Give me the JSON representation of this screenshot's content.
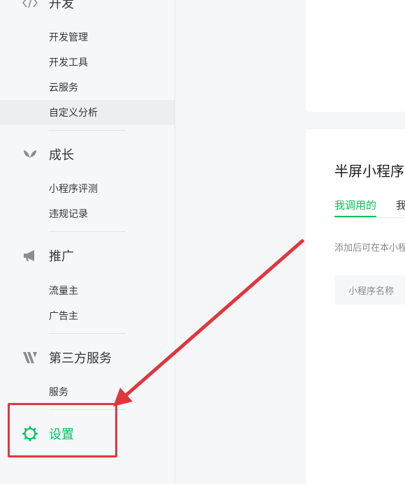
{
  "sidebar": {
    "develop": {
      "label": "开发",
      "icon": "code-icon",
      "items": [
        "开发管理",
        "开发工具",
        "云服务",
        "自定义分析"
      ]
    },
    "growth": {
      "label": "成长",
      "icon": "sprout-icon",
      "items": [
        "小程序评测",
        "违规记录"
      ]
    },
    "promote": {
      "label": "推广",
      "icon": "megaphone-icon",
      "items": [
        "流量主",
        "广告主"
      ]
    },
    "third_party": {
      "label": "第三方服务",
      "icon": "third-party-icon",
      "items": [
        "服务"
      ]
    },
    "settings": {
      "label": "设置",
      "icon": "gear-icon"
    }
  },
  "main": {
    "card_title": "半屏小程序",
    "tabs": [
      "我调用的",
      "我"
    ],
    "hint": "添加后可在本小程",
    "table_header": "小程序名称"
  },
  "colors": {
    "accent": "#07c160",
    "annotation": "#e0373d",
    "text": "#353535"
  }
}
